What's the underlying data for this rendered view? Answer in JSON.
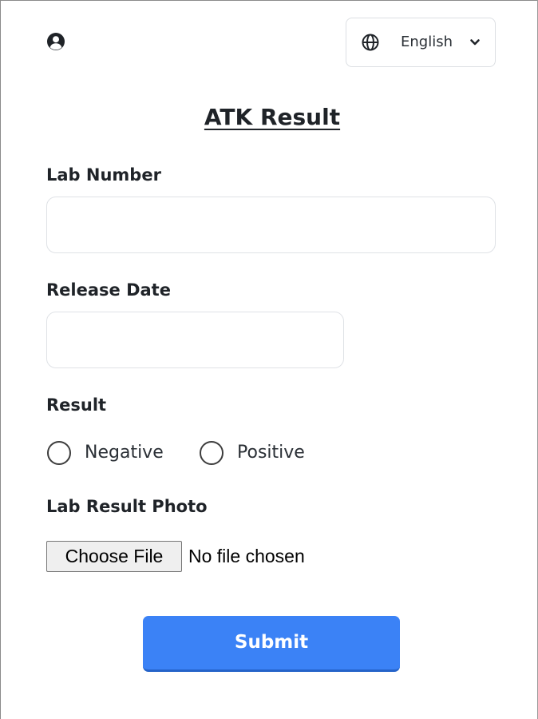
{
  "header": {
    "user_icon": "user-circle-icon",
    "language": {
      "icon": "globe-icon",
      "selected": "English",
      "chevron_icon": "chevron-down-icon"
    }
  },
  "title": "ATK Result",
  "form": {
    "lab_number": {
      "label": "Lab Number",
      "value": "",
      "placeholder": ""
    },
    "release_date": {
      "label": "Release Date",
      "value": "",
      "placeholder": ""
    },
    "result": {
      "label": "Result",
      "options": [
        {
          "label": "Negative",
          "checked": false
        },
        {
          "label": "Positive",
          "checked": false
        }
      ]
    },
    "photo": {
      "label": "Lab Result Photo",
      "button_label": "Choose File",
      "status": "No file chosen"
    },
    "submit_label": "Submit"
  },
  "colors": {
    "accent": "#3b82f6",
    "text": "#1f2328",
    "input_border": "#dfe2e6"
  }
}
